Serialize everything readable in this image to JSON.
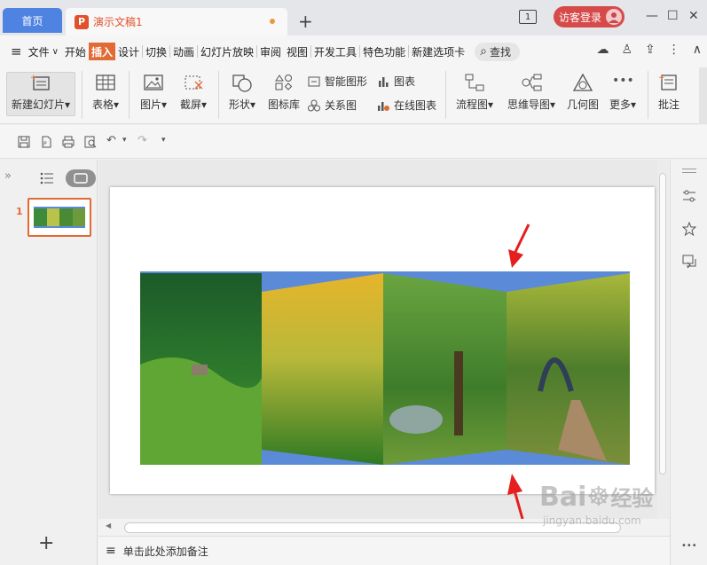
{
  "titlebar": {
    "home_tab": "首页",
    "doc_tab": "演示文稿1",
    "doc_icon": "P",
    "add_tab": "+",
    "badge": "1",
    "login": "访客登录",
    "minimize": "—",
    "maximize": "☐",
    "close": "✕"
  },
  "menubar": {
    "menu_icon": "≡",
    "file": "文件",
    "file_arrow": "∨",
    "items": [
      "开始",
      "插入",
      "设计",
      "切换",
      "动画",
      "幻灯片放映",
      "审阅",
      "视图",
      "开发工具",
      "特色功能",
      "新建选项卡"
    ],
    "active": "插入",
    "search": "查找",
    "search_icon": "⌕",
    "right_icons": [
      "☁",
      "♙",
      "⇪",
      "⋮",
      "∧"
    ]
  },
  "ribbon": {
    "new_slide": "新建幻灯片",
    "table": "表格",
    "picture": "图片",
    "screenshot": "截屏",
    "shape": "形状",
    "icon_lib": "图标库",
    "smart_shape": "智能图形",
    "relation": "关系图",
    "chart": "图表",
    "online_chart": "在线图表",
    "flowchart": "流程图",
    "mindmap": "思维导图",
    "geometry": "几何图",
    "more": "更多",
    "more_icon": "•••",
    "comment": "批注",
    "dropdown": "▾"
  },
  "quick": {
    "undo": "↶",
    "redo": "↷",
    "dropdown": "▾"
  },
  "leftpane": {
    "collapse": "»",
    "slide_number": "1",
    "add": "+"
  },
  "notes": {
    "icon": "≡",
    "placeholder": "单击此处添加备注"
  },
  "rightpane": {
    "more": "•••"
  },
  "watermark": {
    "brand": "Bai",
    "brand2": "经验",
    "url": "jingyan.baidu.com"
  },
  "colors": {
    "accent": "#e26a34",
    "home_tab": "#4f83e2",
    "login": "#d64a4a",
    "band": "#5b8ad8",
    "arrow": "#e61e1e"
  }
}
